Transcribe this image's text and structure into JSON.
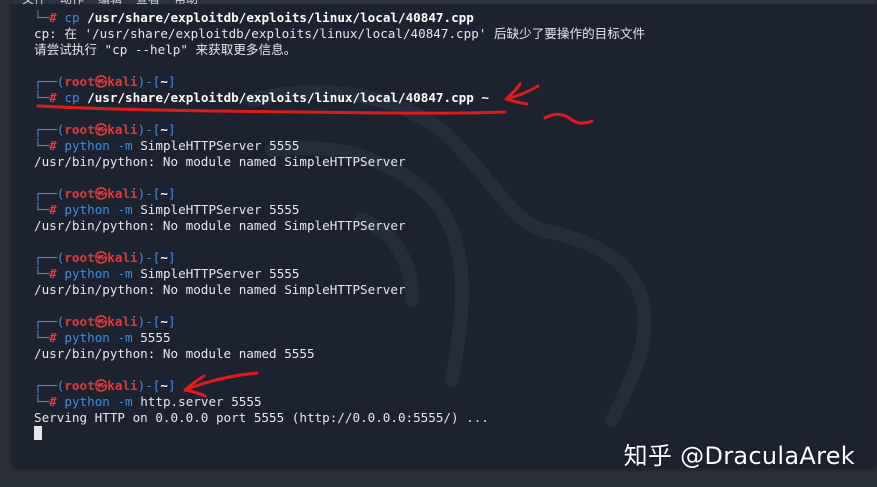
{
  "menubar": {
    "items": [
      "文件",
      "动作",
      "编辑",
      "查看",
      "帮助"
    ]
  },
  "terminal": {
    "prompt": {
      "user": "root",
      "at": "㉿",
      "host": "kali",
      "dir": "~",
      "hash": "#"
    },
    "lines": [
      {
        "kind": "cmd_only",
        "cmd": "cp",
        "args": "/usr/share/exploitdb/exploits/linux/local/40847.cpp"
      },
      {
        "kind": "output",
        "text": "cp: 在 '/usr/share/exploitdb/exploits/linux/local/40847.cpp' 后缺少了要操作的目标文件"
      },
      {
        "kind": "output",
        "text": "请尝试执行 \"cp --help\" 来获取更多信息。"
      },
      {
        "kind": "blank"
      },
      {
        "kind": "prompt"
      },
      {
        "kind": "cmd",
        "cmd": "cp",
        "args": "/usr/share/exploitdb/exploits/linux/local/40847.cpp ~"
      },
      {
        "kind": "blank"
      },
      {
        "kind": "prompt"
      },
      {
        "kind": "cmd",
        "cmd": "python",
        "flag": "-m",
        "args": "SimpleHTTPServer 5555"
      },
      {
        "kind": "output",
        "text": "/usr/bin/python: No module named SimpleHTTPServer"
      },
      {
        "kind": "blank"
      },
      {
        "kind": "prompt"
      },
      {
        "kind": "cmd",
        "cmd": "python",
        "flag": "-m",
        "args": "SimpleHTTPServer 5555"
      },
      {
        "kind": "output",
        "text": "/usr/bin/python: No module named SimpleHTTPServer"
      },
      {
        "kind": "blank"
      },
      {
        "kind": "prompt"
      },
      {
        "kind": "cmd",
        "cmd": "python",
        "flag": "-m",
        "args": "SimpleHTTPServer 5555"
      },
      {
        "kind": "output",
        "text": "/usr/bin/python: No module named SimpleHTTPServer"
      },
      {
        "kind": "blank"
      },
      {
        "kind": "prompt"
      },
      {
        "kind": "cmd",
        "cmd": "python",
        "flag": "-m",
        "args": "5555"
      },
      {
        "kind": "output",
        "text": "/usr/bin/python: No module named 5555"
      },
      {
        "kind": "blank"
      },
      {
        "kind": "prompt"
      },
      {
        "kind": "cmd",
        "cmd": "python",
        "flag": "-m",
        "args": "http.server 5555"
      },
      {
        "kind": "output",
        "text": "Serving HTTP on 0.0.0.0 port 5555 (http://0.0.0.0:5555/) ..."
      },
      {
        "kind": "cursor"
      }
    ]
  },
  "watermark": {
    "text": "知乎 @DraculaArek"
  },
  "colors": {
    "background": "#1c2230",
    "prompt_blue": "#3d8ee6",
    "prompt_red": "#e23a3a",
    "annotation_red": "#e01b1b"
  }
}
